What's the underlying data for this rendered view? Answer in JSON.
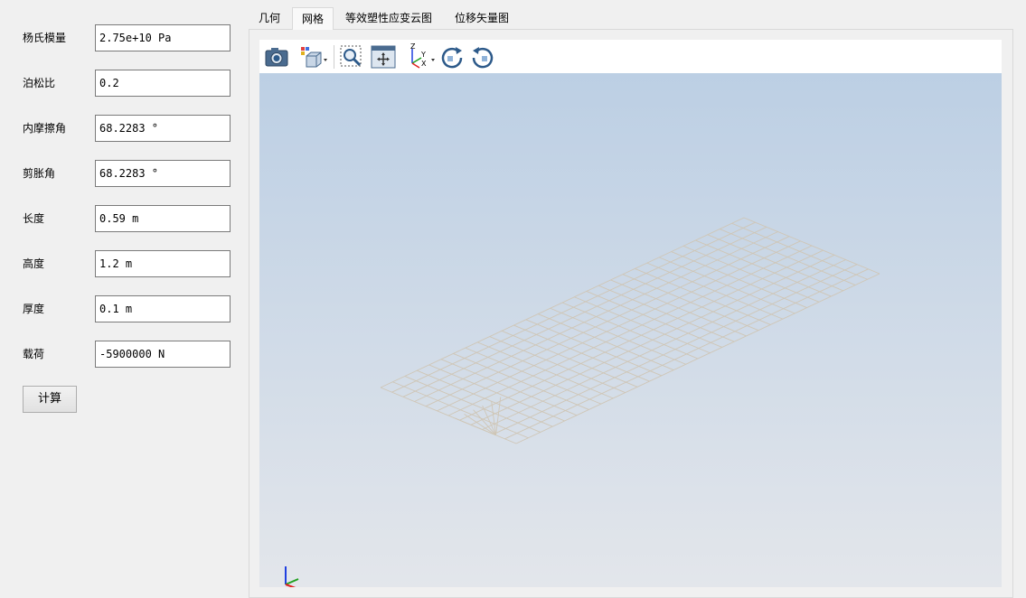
{
  "params": [
    {
      "label": "杨氏模量",
      "value": "2.75e+10 Pa"
    },
    {
      "label": "泊松比",
      "value": "0.2"
    },
    {
      "label": "内摩擦角",
      "value": "68.2283 °"
    },
    {
      "label": "剪胀角",
      "value": "68.2283 °"
    },
    {
      "label": "长度",
      "value": "0.59 m"
    },
    {
      "label": "高度",
      "value": "1.2 m"
    },
    {
      "label": "厚度",
      "value": "0.1 m"
    },
    {
      "label": "载荷",
      "value": "-5900000 N"
    }
  ],
  "calc_button": "计算",
  "tabs": [
    {
      "label": "几何",
      "active": false
    },
    {
      "label": "网格",
      "active": true
    },
    {
      "label": "等效塑性应变云图",
      "active": false
    },
    {
      "label": "位移矢量图",
      "active": false
    }
  ],
  "toolbar": {
    "items": [
      "camera-icon",
      "view-cube-icon",
      "zoom-window-icon",
      "fit-all-icon",
      "axes-view-icon",
      "rotate-cw-icon",
      "rotate-ccw-icon"
    ],
    "axis_labels": {
      "x": "X",
      "y": "Y",
      "z": "Z"
    }
  },
  "mesh": {
    "divisions_long": 30,
    "divisions_short": 12,
    "color": "#cfc6b6"
  },
  "colors": {
    "background_top": "#bccfe4",
    "background_bottom": "#e3e6eb",
    "axis_x": "#e02020",
    "axis_y": "#20a020",
    "axis_z": "#2040e0"
  }
}
